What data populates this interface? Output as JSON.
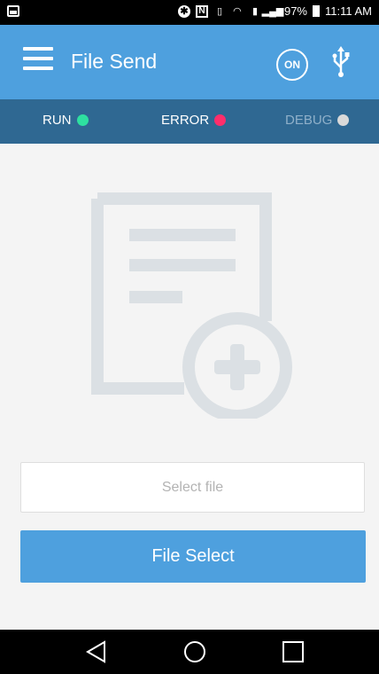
{
  "statusbar": {
    "battery": "97%",
    "time": "11:11 AM"
  },
  "appbar": {
    "title": "File Send",
    "on_label": "ON"
  },
  "indicators": [
    {
      "label": "RUN",
      "color": "#2ee0a0"
    },
    {
      "label": "ERROR",
      "color": "#ff2e6b"
    },
    {
      "label": "DEBUG",
      "color": "#d9d9d9"
    }
  ],
  "file_field": {
    "placeholder": "Select file"
  },
  "select_button": {
    "label": "File Select"
  },
  "colors": {
    "appbar": "#4ea0de",
    "status_row": "#2f6892",
    "illustration": "#dbe0e4"
  },
  "icons": {
    "menu": "hamburger-menu-icon",
    "usb": "usb-icon",
    "document": "document-add-icon",
    "nav_back": "back-triangle-icon",
    "nav_home": "home-circle-icon",
    "nav_recent": "recent-square-icon"
  }
}
